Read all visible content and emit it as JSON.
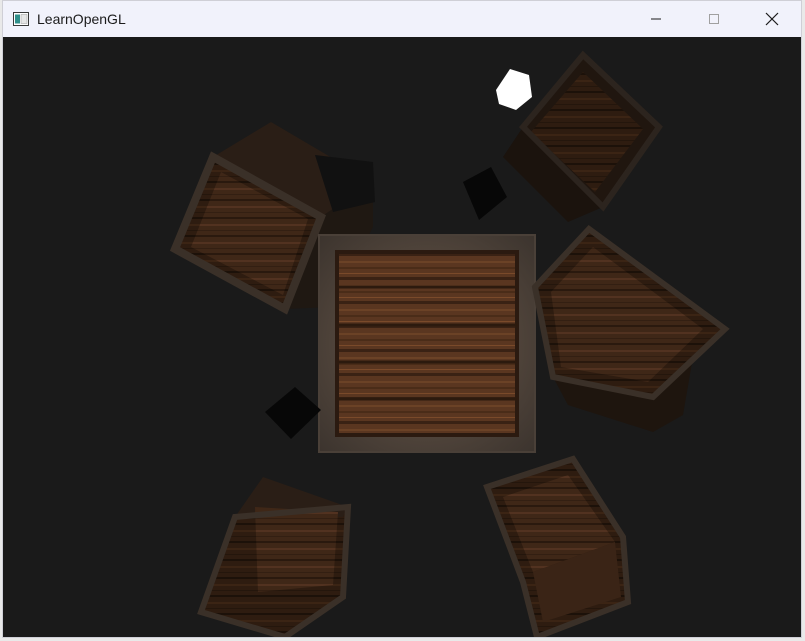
{
  "window": {
    "title": "LearnOpenGL"
  },
  "controls": {
    "minimize": "minimize-icon",
    "maximize": "maximize-icon",
    "close": "close-icon"
  },
  "colors": {
    "clear_color": "#1a1a1a",
    "titlebar": "#f1f2fb",
    "light_cube": "#ffffff",
    "wood_dark": "#2b1a10",
    "wood_mid": "#5a3620",
    "wood_light": "#7a4a2a",
    "metal_frame": "#5b5148"
  }
}
